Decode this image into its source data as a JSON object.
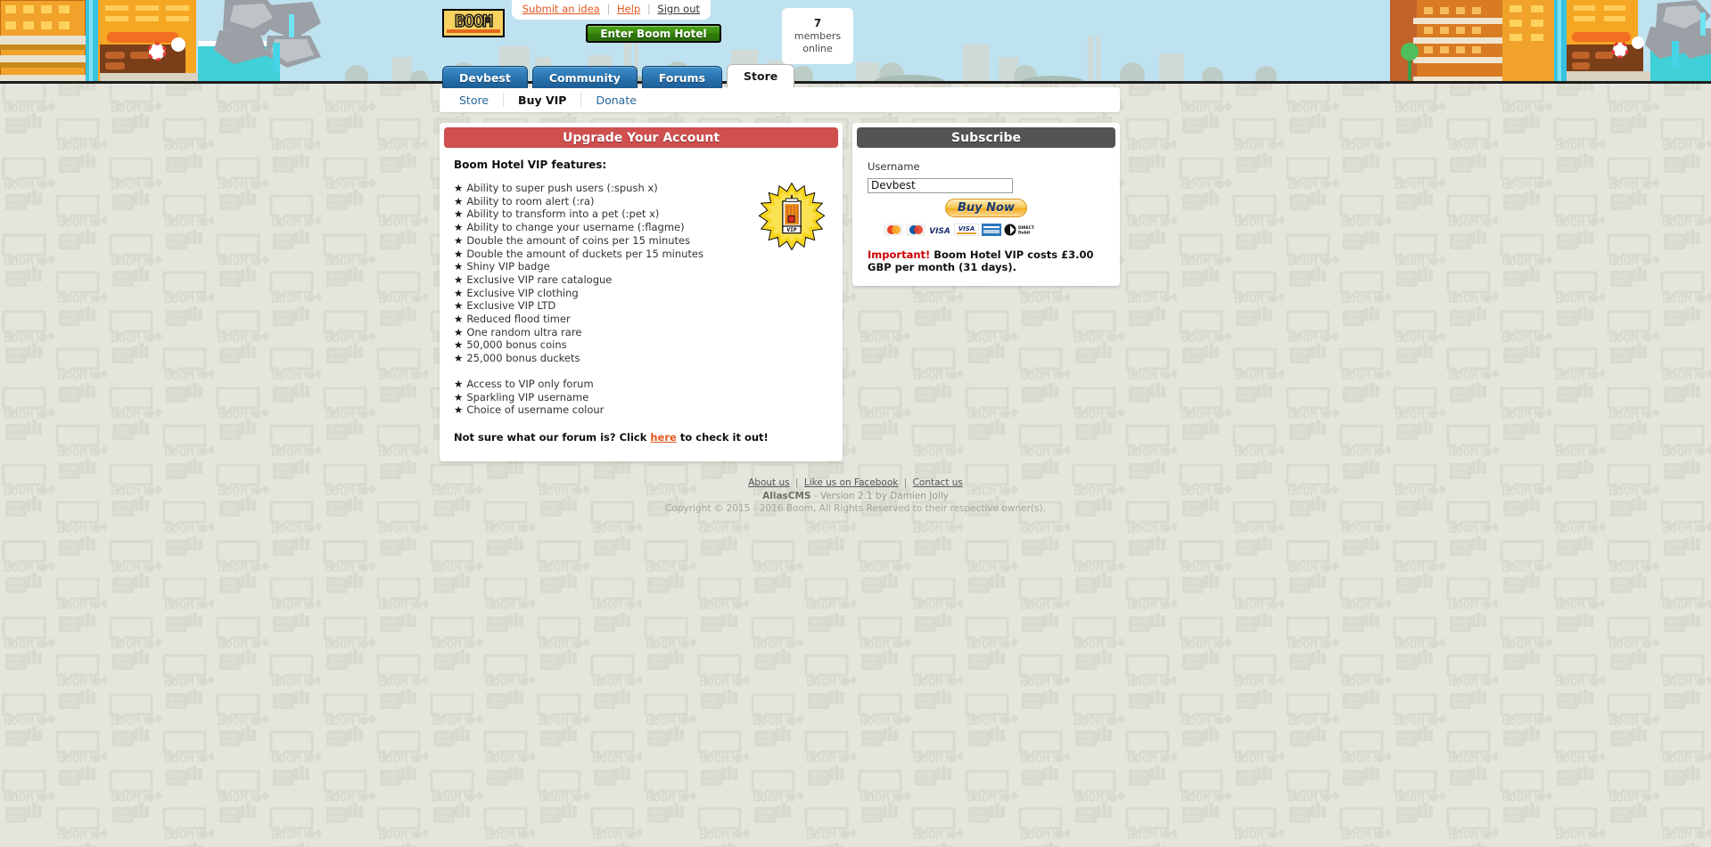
{
  "site": {
    "logo_text": "BOOM",
    "title": "Boom Hotel"
  },
  "header": {
    "links": [
      {
        "label": "Submit an idea",
        "style": "orange"
      },
      {
        "label": "Help",
        "style": "orange"
      },
      {
        "label": "Sign out",
        "style": "dark"
      }
    ],
    "enter_button": "Enter Boom Hotel",
    "members_online": {
      "count": "7",
      "line1": "members",
      "line2": "online"
    }
  },
  "tabs": [
    {
      "label": "Devbest",
      "active": false
    },
    {
      "label": "Community",
      "active": false
    },
    {
      "label": "Forums",
      "active": false
    },
    {
      "label": "Store",
      "active": true
    }
  ],
  "subnav": [
    {
      "label": "Store",
      "active": false
    },
    {
      "label": "Buy VIP",
      "active": true
    },
    {
      "label": "Donate",
      "active": false
    }
  ],
  "upgrade_panel": {
    "heading": "Upgrade Your Account",
    "features_title": "Boom Hotel VIP features:",
    "features_group_1": [
      "Ability to super push users (:spush x)",
      "Ability to room alert (:ra)",
      "Ability to transform into a pet (:pet x)",
      "Ability to change your username (:flagme)",
      "Double the amount of coins per 15 minutes",
      "Double the amount of duckets per 15 minutes",
      "Shiny VIP badge",
      "Exclusive VIP rare catalogue",
      "Exclusive VIP clothing",
      "Exclusive VIP LTD",
      "Reduced flood timer",
      "One random ultra rare",
      "50,000 bonus coins",
      "25,000 bonus duckets"
    ],
    "features_group_2": [
      "Access to VIP only forum",
      "Sparkling VIP username",
      "Choice of username colour"
    ],
    "bullet_char": "★",
    "forum_note_before": "Not sure what our forum is? Click ",
    "forum_note_link": "here",
    "forum_note_after": " to check it out!",
    "badge_label": "VIP"
  },
  "subscribe_panel": {
    "heading": "Subscribe",
    "username_label": "Username",
    "username_value": "Devbest",
    "username_placeholder": "Username",
    "buy_button": "Buy Now",
    "cards": [
      {
        "name": "mastercard-icon",
        "label": "MasterCard"
      },
      {
        "name": "maestro-icon",
        "label": "Maestro"
      },
      {
        "name": "visa-icon",
        "label": "VISA"
      },
      {
        "name": "visa-electron-icon",
        "label": "VISA Electron"
      },
      {
        "name": "amex-icon",
        "label": "AMEX"
      },
      {
        "name": "direct-debit-icon",
        "label": "DIRECT Debit"
      }
    ],
    "important_flag": "Important!",
    "important_text": " Boom Hotel VIP costs £3.00 GBP per month (31 days)."
  },
  "footer": {
    "links": [
      "About us",
      "Like us on Facebook",
      "Contact us"
    ],
    "cms_name": "AliasCMS",
    "cms_version": " - Version 2.1 by Damien Jolly",
    "copyright": "Copyright © 2015 - 2016 Boom, All Rights Reserved to their respective owner(s)."
  },
  "colors": {
    "accent_red": "#d04f4f",
    "accent_grey": "#545454",
    "tab_blue": "#2e7ab6",
    "link_orange": "#e2571e",
    "page_bg": "#e5e5dd",
    "sky": "#bfe2f0",
    "enter_green": "#3d8f10"
  }
}
